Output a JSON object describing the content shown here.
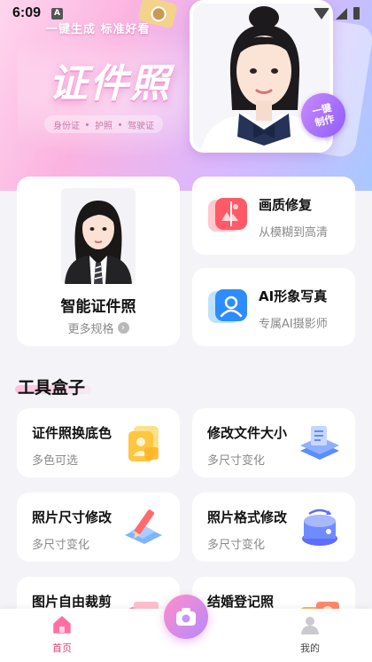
{
  "status_bar": {
    "time": "6:09",
    "notification_icon": "A"
  },
  "hero": {
    "tagline": "一键生成 标准好看",
    "title": "证件照",
    "tags": [
      "身份证",
      "护照",
      "驾驶证"
    ],
    "badge_line1": "一键",
    "badge_line2": "制作"
  },
  "main_card": {
    "title": "智能证件照",
    "subtitle": "更多规格"
  },
  "features": [
    {
      "title": "画质修复",
      "subtitle": "从模糊到高清",
      "icon": "image-repair-icon"
    },
    {
      "title": "AI形象写真",
      "subtitle": "专属AI摄影师",
      "icon": "ai-portrait-icon"
    }
  ],
  "toolbox": {
    "title": "工具盒子",
    "items": [
      {
        "title": "证件照换底色",
        "subtitle": "多色可选",
        "icon": "id-photo-stack-icon"
      },
      {
        "title": "修改文件大小",
        "subtitle": "多尺寸变化",
        "icon": "file-layers-icon"
      },
      {
        "title": "照片尺寸修改",
        "subtitle": "多尺寸变化",
        "icon": "ruler-pencil-icon"
      },
      {
        "title": "照片格式修改",
        "subtitle": "多尺寸变化",
        "icon": "format-convert-icon"
      },
      {
        "title": "图片自由裁剪",
        "subtitle": "",
        "icon": "crop-icon"
      },
      {
        "title": "结婚登记照",
        "subtitle": "",
        "icon": "wedding-camera-icon"
      }
    ]
  },
  "tabbar": {
    "home_label": "首页",
    "me_label": "我的"
  },
  "colors": {
    "accent": "#e0407a",
    "fab_start": "#ff8ec8",
    "fab_end": "#b788ff"
  }
}
